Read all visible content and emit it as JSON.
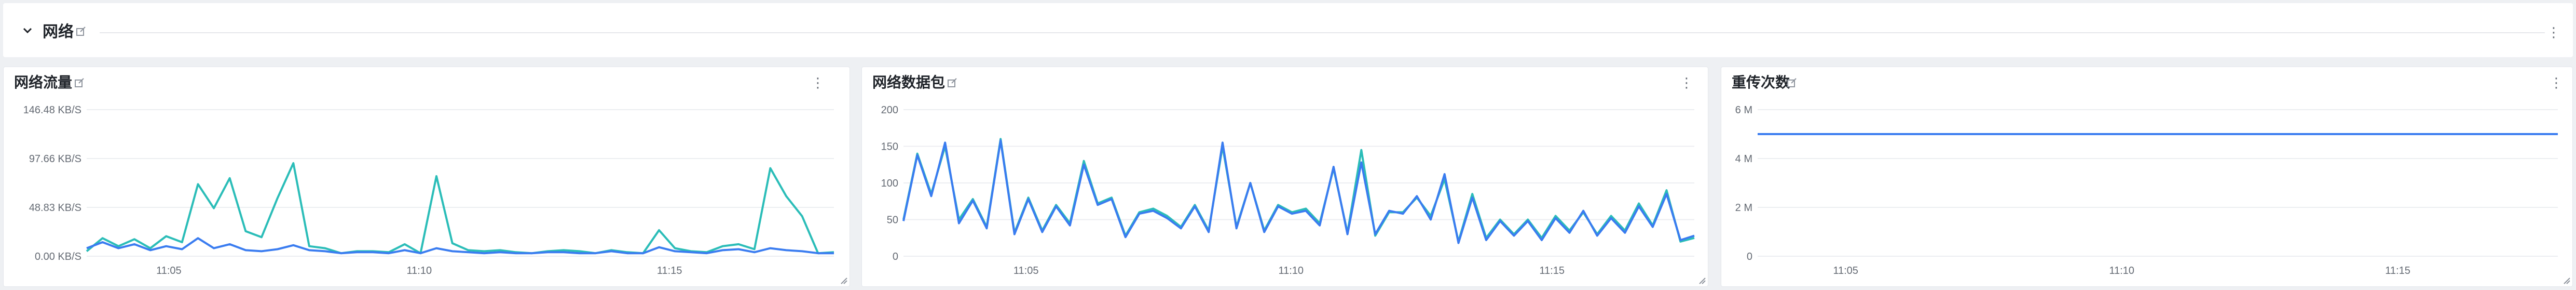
{
  "section": {
    "title": "网络",
    "collapse_icon": "chevron-down-icon",
    "edit_icon": "edit-icon",
    "more_icon": "more-vertical-icon"
  },
  "colors": {
    "series_primary": "#2bbdb8",
    "series_secondary": "#3a7cf0",
    "grid": "#eceef1",
    "axis_text": "#646a73"
  },
  "panels": [
    {
      "title": "网络流量",
      "chart_data": {
        "type": "line",
        "title": "网络流量",
        "ylim": [
          0,
          146.48
        ],
        "y_ticks": [
          "146.48 KB/S",
          "97.66 KB/S",
          "48.83 KB/S",
          "0.00 KB/S"
        ],
        "x_ticks": [
          "11:05",
          "11:10",
          "11:15"
        ],
        "x": [
          "11:02",
          "11:02",
          "11:03",
          "11:03",
          "11:04",
          "11:04",
          "11:05",
          "11:05",
          "11:06",
          "11:06",
          "11:07",
          "11:07",
          "11:08",
          "11:08",
          "11:09",
          "11:09",
          "11:10",
          "11:10",
          "11:11",
          "11:11",
          "11:12",
          "11:12",
          "11:13",
          "11:13",
          "11:14",
          "11:14",
          "11:15",
          "11:15",
          "11:16",
          "11:16",
          "11:17",
          "11:17"
        ],
        "series": [
          {
            "values": [
              5,
              18,
              10,
              17,
              8,
              20,
              14,
              72,
              48,
              78,
              25,
              19,
              58,
              93,
              10,
              8,
              3,
              5,
              5,
              4,
              12,
              3,
              80,
              13,
              6,
              5,
              6,
              4,
              3,
              5,
              6,
              5,
              3,
              6,
              4,
              3,
              26,
              8,
              5,
              4,
              10,
              12,
              7,
              88,
              60,
              40,
              3,
              4
            ]
          },
          {
            "values": [
              8,
              14,
              8,
              12,
              6,
              10,
              7,
              18,
              8,
              12,
              6,
              5,
              7,
              11,
              6,
              5,
              3,
              4,
              4,
              3,
              6,
              3,
              8,
              5,
              4,
              3,
              4,
              3,
              3,
              4,
              4,
              3,
              3,
              5,
              3,
              3,
              9,
              5,
              4,
              3,
              6,
              7,
              4,
              8,
              6,
              5,
              3,
              3
            ]
          }
        ]
      }
    },
    {
      "title": "网络数据包",
      "chart_data": {
        "type": "line",
        "title": "网络数据包",
        "ylim": [
          0,
          200
        ],
        "y_ticks": [
          "200",
          "150",
          "100",
          "50",
          "0"
        ],
        "x_ticks": [
          "11:05",
          "11:10",
          "11:15"
        ],
        "series": [
          {
            "values": [
              50,
              140,
              85,
              150,
              50,
              78,
              40,
              160,
              32,
              80,
              35,
              70,
              45,
              130,
              72,
              80,
              28,
              60,
              65,
              55,
              40,
              70,
              35,
              150,
              40,
              100,
              35,
              70,
              60,
              65,
              45,
              120,
              32,
              145,
              28,
              60,
              60,
              80,
              55,
              105,
              20,
              85,
              25,
              50,
              30,
              50,
              25,
              55,
              35,
              60,
              30,
              55,
              35,
              72,
              42,
              90,
              20,
              25
            ]
          },
          {
            "values": [
              48,
              138,
              82,
              155,
              45,
              76,
              38,
              158,
              30,
              78,
              33,
              68,
              42,
              125,
              70,
              78,
              26,
              58,
              62,
              52,
              38,
              68,
              33,
              155,
              38,
              100,
              33,
              68,
              58,
              62,
              42,
              122,
              30,
              128,
              30,
              62,
              58,
              82,
              50,
              112,
              18,
              80,
              22,
              48,
              28,
              48,
              22,
              52,
              32,
              62,
              28,
              52,
              32,
              68,
              40,
              85,
              22,
              28
            ]
          }
        ]
      }
    },
    {
      "title": "重传次数",
      "chart_data": {
        "type": "line",
        "title": "重传次数",
        "ylim": [
          0,
          6000000
        ],
        "y_ticks": [
          "6 M",
          "4 M",
          "2 M",
          "0"
        ],
        "x_ticks": [
          "11:05",
          "11:10",
          "11:15"
        ],
        "series": [
          {
            "values": [
              5000000,
              5000000
            ]
          }
        ]
      }
    }
  ]
}
